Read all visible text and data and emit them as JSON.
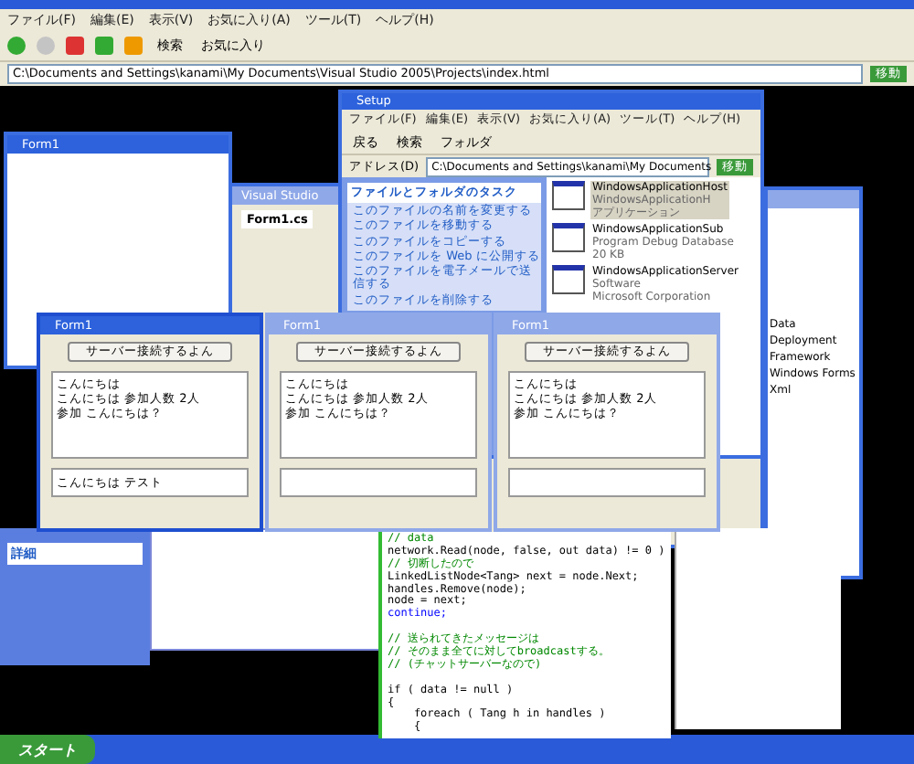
{
  "browser": {
    "menu": [
      "ファイル(F)",
      "編集(E)",
      "表示(V)",
      "お気に入り(A)",
      "ツール(T)",
      "ヘルプ(H)"
    ],
    "toolbar": [
      "検索",
      "お気に入り"
    ],
    "address": "C:\\Documents and Settings\\kanami\\My Documents\\Visual Studio 2005\\Projects\\index.html",
    "go": "移動"
  },
  "explorer": {
    "title": "Setup",
    "menu": [
      "ファイル(F)",
      "編集(E)",
      "表示(V)",
      "お気に入り(A)",
      "ツール(T)",
      "ヘルプ(H)"
    ],
    "toolbar": [
      "戻る",
      "検索",
      "フォルダ"
    ],
    "address_label": "アドレス(D)",
    "address": "C:\\Documents and Settings\\kanami\\My Documents",
    "go": "移動",
    "task_title": "ファイルとフォルダのタスク",
    "tasks": [
      "このファイルの名前を変更する",
      "このファイルを移動する",
      "このファイルをコピーする",
      "このファイルを Web に公開する",
      "このファイルを電子メールで送信する",
      "このファイルを削除する"
    ],
    "files": [
      {
        "name": "WindowsApplicationHost",
        "line_2": "WindowsApplicationH",
        "line_3": "アプリケーション",
        "selected": true
      },
      {
        "name": "WindowsApplicationSub",
        "line_2": "Program Debug Database",
        "line_3": "20 KB",
        "selected": false
      },
      {
        "name": "WindowsApplicationServer",
        "line_2": "Software",
        "line_3": "Microsoft Corporation",
        "selected": false
      }
    ]
  },
  "vs": {
    "title": "Visual Studio",
    "tabs": [
      {
        "label": "Form1.cs",
        "selected": true
      }
    ]
  },
  "empty_form": {
    "title": "Form1"
  },
  "forms": [
    {
      "title": "Form1",
      "active": true,
      "button": "サーバー接続するよん",
      "lines": [
        "こんにちは",
        "こんにちは 参加人数 2人",
        "参加 こんにちは？"
      ],
      "input": "こんにちは テスト"
    },
    {
      "title": "Form1",
      "active": false,
      "button": "サーバー接続するよん",
      "lines": [
        "こんにちは",
        "こんにちは 参加人数 2人",
        "参加 こんにちは？"
      ]
    },
    {
      "title": "Form1",
      "active": false,
      "button": "サーバー接続するよん",
      "lines": [
        "こんにちは",
        "こんにちは 参加人数 2人",
        "参加 こんにちは？"
      ]
    }
  ],
  "solution": {
    "items": [
      "Data",
      "Deployment",
      "Framework",
      "Windows Forms",
      "Xml"
    ]
  },
  "code": [
    {
      "kind": "comment",
      "text": "// data"
    },
    {
      "kind": "code",
      "text": "network.Read(node, false, out data) != 0 )"
    },
    {
      "kind": "comment",
      "text": "// 切断したので"
    },
    {
      "kind": "code",
      "text": "LinkedListNode<Tang> next = node.Next;"
    },
    {
      "kind": "code",
      "text": "handles.Remove(node);"
    },
    {
      "kind": "code",
      "text": "node = next;"
    },
    {
      "kind": "keyword",
      "text": "continue;"
    },
    {
      "kind": "blank"
    },
    {
      "kind": "comment",
      "text": "// 送られてきたメッセージは"
    },
    {
      "kind": "comment",
      "text": "// そのまま全てに対してbroadcastする。"
    },
    {
      "kind": "comment",
      "text": "// (チャットサーバーなので)"
    },
    {
      "kind": "blank"
    },
    {
      "kind": "code",
      "text": "if ( data != null )"
    },
    {
      "kind": "code",
      "text": "{"
    },
    {
      "kind": "code",
      "text": "    foreach ( Tang h in handles )"
    },
    {
      "kind": "code",
      "text": "    {"
    }
  ],
  "sidebar": {
    "title": "詳細"
  },
  "taskbar": {
    "start": "スタート"
  }
}
